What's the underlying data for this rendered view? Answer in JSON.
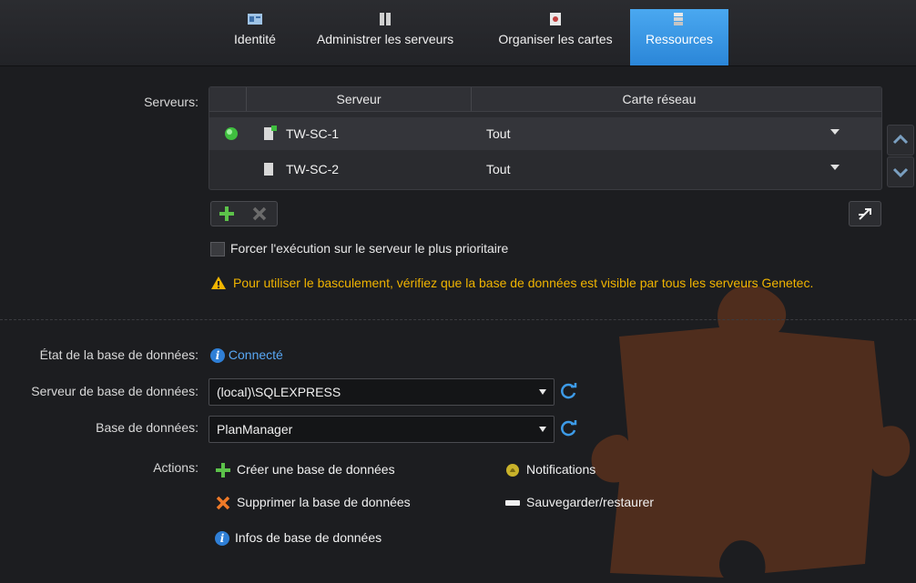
{
  "tabs": [
    {
      "label": "Identité",
      "icon": "id-card-icon"
    },
    {
      "label": "Administrer les serveurs",
      "icon": "servers-icon"
    },
    {
      "label": "Organiser les cartes",
      "icon": "map-icon"
    },
    {
      "label": "Ressources",
      "icon": "resources-icon",
      "active": true
    }
  ],
  "servers": {
    "label": "Serveurs:",
    "columns": [
      "Serveur",
      "Carte réseau"
    ],
    "rows": [
      {
        "status": "online",
        "name": "TW-SC-1",
        "nic": "Tout"
      },
      {
        "status": "",
        "name": "TW-SC-2",
        "nic": "Tout"
      }
    ]
  },
  "force_checkbox": {
    "label": "Forcer l'exécution sur le serveur le plus prioritaire",
    "checked": false
  },
  "warning": "Pour utiliser le basculement, vérifiez que la base de données est visible par tous les serveurs Genetec.",
  "db": {
    "state_label": "État de la base de données:",
    "state_value": "Connecté",
    "server_label": "Serveur de base de données:",
    "server_value": "(local)\\SQLEXPRESS",
    "database_label": "Base de données:",
    "database_value": "PlanManager",
    "actions_label": "Actions:"
  },
  "actions": {
    "create": "Créer une base de données",
    "delete": "Supprimer la base de données",
    "info": "Infos de base de données",
    "notifications": "Notifications",
    "backup": "Sauvegarder/restaurer"
  },
  "colors": {
    "accent": "#2b86d8",
    "warning": "#f0b400",
    "link": "#59a8f5",
    "background": "#1c1d20"
  }
}
